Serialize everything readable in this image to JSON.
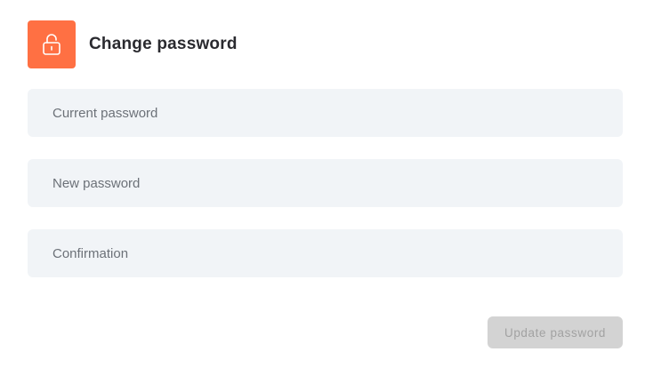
{
  "header": {
    "title": "Change password",
    "icon": "unlock-icon"
  },
  "form": {
    "fields": [
      {
        "placeholder": "Current password",
        "value": ""
      },
      {
        "placeholder": "New password",
        "value": ""
      },
      {
        "placeholder": "Confirmation",
        "value": ""
      }
    ],
    "submit_label": "Update password",
    "submit_enabled": false
  },
  "colors": {
    "accent": "#ff7043",
    "field_bg": "#f1f4f7",
    "button_disabled_bg": "#d3d3d3",
    "button_disabled_text": "#a2a2a2"
  }
}
